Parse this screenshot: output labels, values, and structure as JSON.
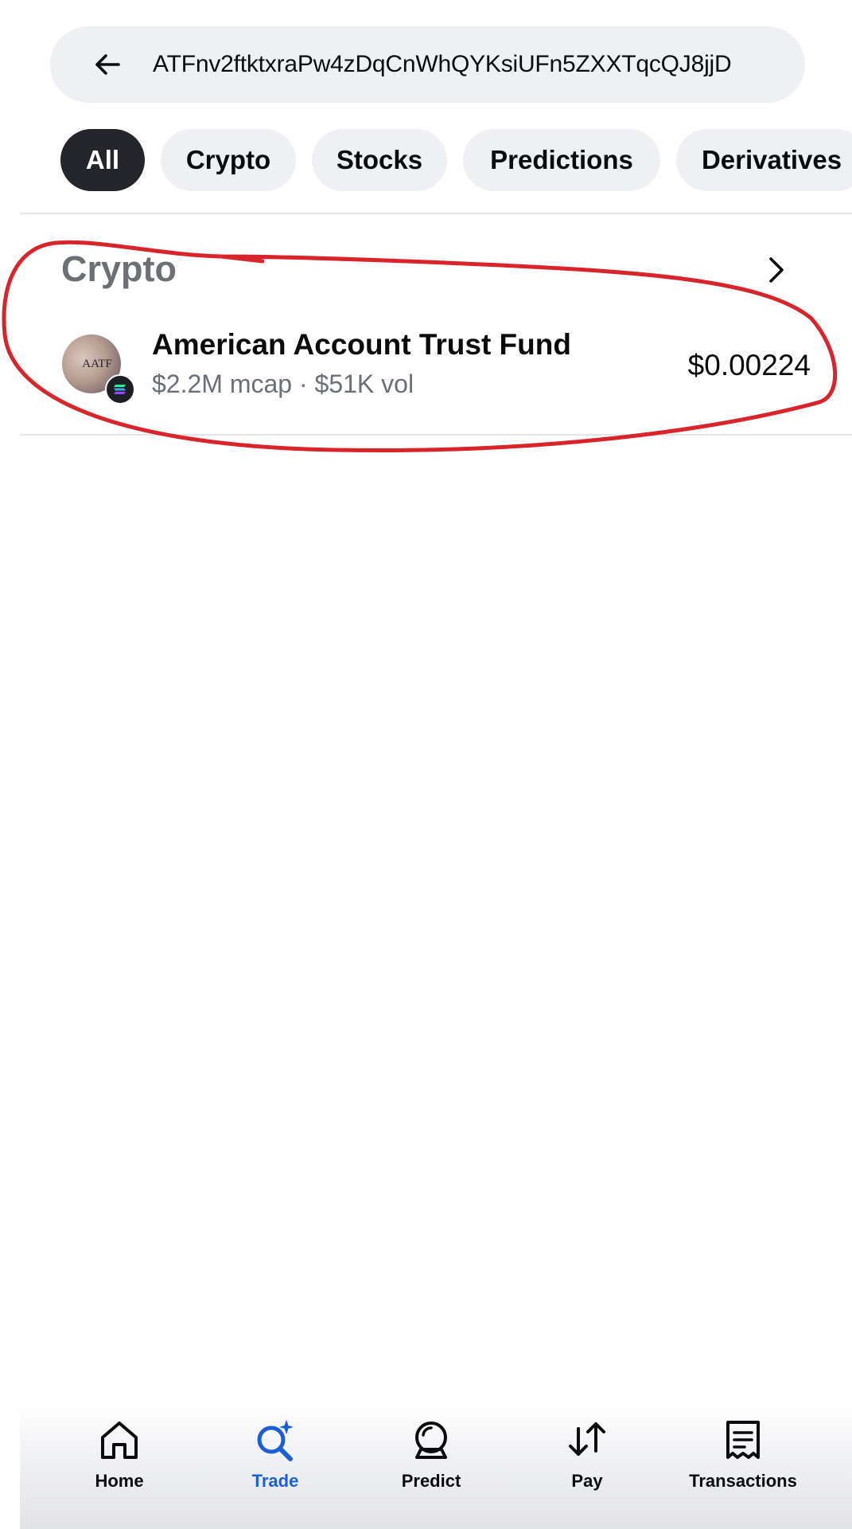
{
  "search": {
    "query": "ATFnv2ftktxraPw4zDqCnWhQYKsiUFn5ZXXTqcQJ8jjD",
    "back_icon": "arrow-left-icon"
  },
  "tabs": [
    {
      "label": "All",
      "active": true
    },
    {
      "label": "Crypto",
      "active": false
    },
    {
      "label": "Stocks",
      "active": false
    },
    {
      "label": "Predictions",
      "active": false
    },
    {
      "label": "Derivatives",
      "active": false
    }
  ],
  "section": {
    "title": "Crypto",
    "chevron_icon": "chevron-right-icon"
  },
  "results": [
    {
      "name": "American Account Trust Fund",
      "stats": "$2.2M mcap · $51K vol",
      "price": "$0.00224",
      "logo_text": "AATF",
      "chain_icon": "solana-icon"
    }
  ],
  "bottom_nav": [
    {
      "label": "Home",
      "icon": "home-icon",
      "active": false
    },
    {
      "label": "Trade",
      "icon": "search-sparkle-icon",
      "active": true
    },
    {
      "label": "Predict",
      "icon": "crystal-ball-icon",
      "active": false
    },
    {
      "label": "Pay",
      "icon": "transfer-arrows-icon",
      "active": false
    },
    {
      "label": "Transactions",
      "icon": "receipt-icon",
      "active": false
    }
  ],
  "colors": {
    "accent": "#1b5fd6",
    "annotation": "#d8252b",
    "pill_bg": "#eef0f3",
    "active_pill": "#23252a"
  }
}
